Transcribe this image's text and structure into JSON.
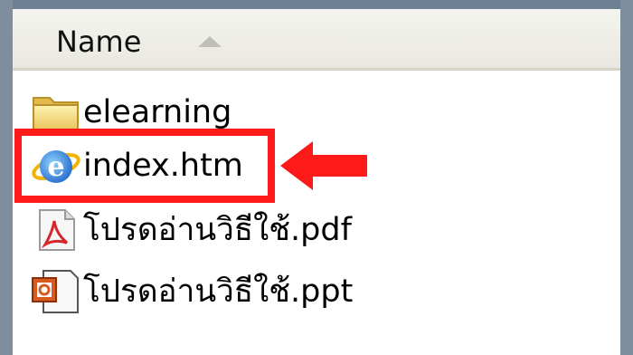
{
  "header": {
    "name_column": "Name",
    "sort_direction": "ascending"
  },
  "files": [
    {
      "label": "elearning",
      "icon": "folder-icon"
    },
    {
      "label": "index.htm",
      "icon": "internet-explorer-icon",
      "highlighted": true
    },
    {
      "label": "โปรดอ่านวิธีใช้.pdf",
      "icon": "pdf-file-icon"
    },
    {
      "label": "โปรดอ่านวิธีใช้.ppt",
      "icon": "powerpoint-file-icon"
    }
  ],
  "colors": {
    "highlight": "#ff1a1a",
    "header_bg": "#ecebe4"
  }
}
